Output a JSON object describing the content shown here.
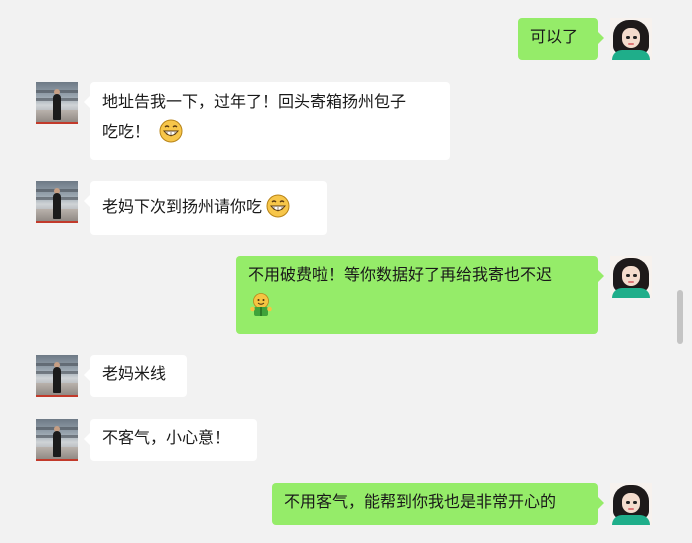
{
  "messages": [
    {
      "side": "out",
      "text": "可以了",
      "emoji": null
    },
    {
      "side": "in",
      "text_line1": "地址告我一下，过年了！回头寄箱扬州包子",
      "text_line2": "吃吃！",
      "emoji": "grin-icon"
    },
    {
      "side": "in",
      "text": "老妈下次到扬州请你吃",
      "emoji": "grin-icon"
    },
    {
      "side": "out",
      "text": "不用破费啦！等你数据好了再给我寄也不迟",
      "emoji": "smile-gift-icon"
    },
    {
      "side": "in",
      "text": "老妈米线",
      "emoji": null
    },
    {
      "side": "in",
      "text": "不客气，小心意！",
      "emoji": null
    },
    {
      "side": "out",
      "text": "不用客气，能帮到你我也是非常开心的",
      "emoji": null
    }
  ],
  "colors": {
    "background": "#f2f2f2",
    "incoming_bubble": "#ffffff",
    "outgoing_bubble": "#95ec69"
  }
}
